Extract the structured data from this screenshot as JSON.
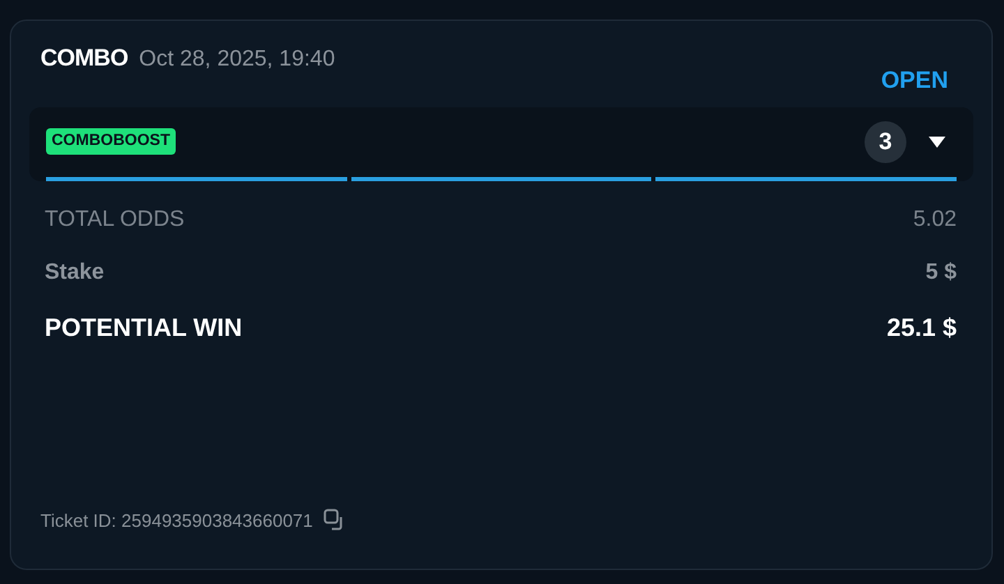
{
  "header": {
    "type": "COMBO",
    "date": "Oct 28, 2025, 19:40",
    "status": "OPEN"
  },
  "legs_panel": {
    "tag": "COMBOBOOST",
    "count": "3",
    "expanded": false,
    "segments": [
      {
        "done": true
      },
      {
        "done": true
      },
      {
        "done": true
      }
    ]
  },
  "rows": [
    {
      "kind": "muted",
      "label": "TOTAL ODDS",
      "value": "5.02"
    },
    {
      "kind": "semi",
      "label": "Stake",
      "value": "5 $"
    },
    {
      "kind": "strong",
      "label": "POTENTIAL WIN",
      "value": "25.1 $"
    }
  ],
  "footer": {
    "ticket_id": "Ticket ID: 2594935903843660071"
  }
}
